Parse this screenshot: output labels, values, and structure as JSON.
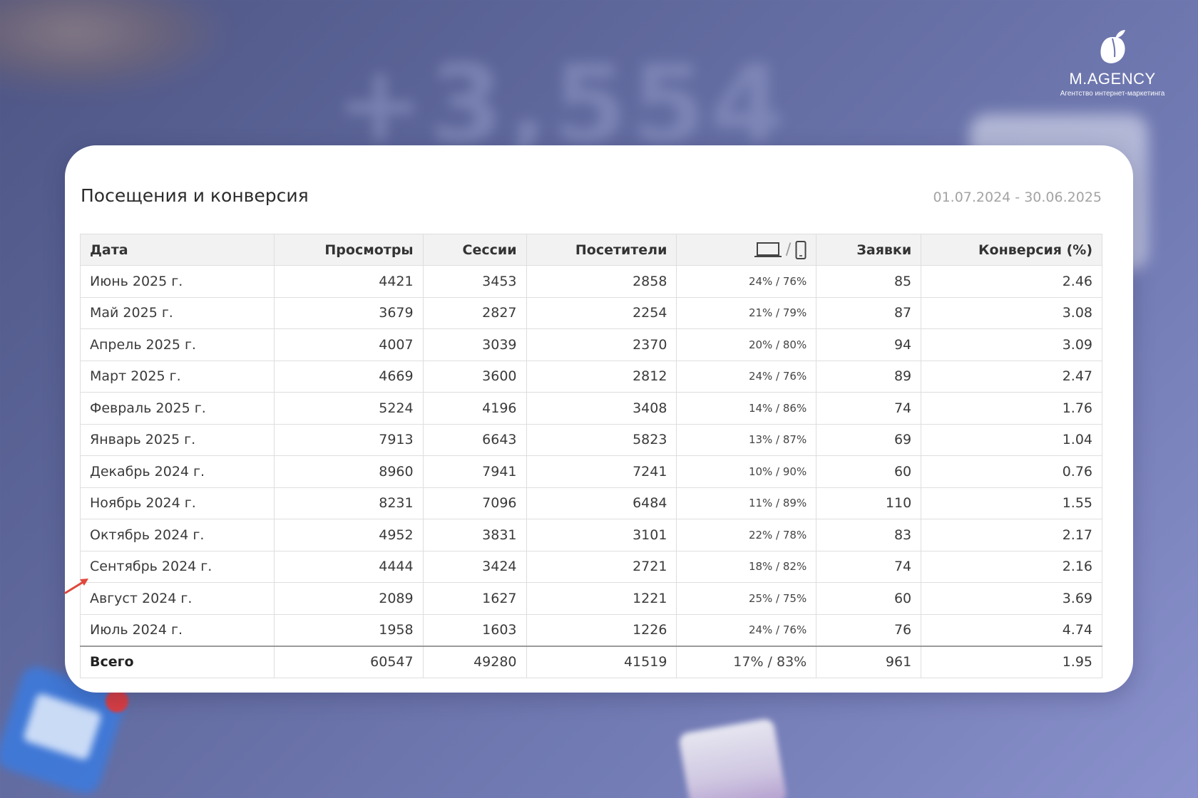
{
  "brand": {
    "name": "M.AGENCY",
    "tagline": "Агентство интернет-маркетинга"
  },
  "background": {
    "big_number": "+3,554"
  },
  "card": {
    "title": "Посещения и конверсия",
    "date_range": "01.07.2024 - 30.06.2025"
  },
  "table": {
    "columns": [
      "Дата",
      "Просмотры",
      "Сессии",
      "Посетители",
      "",
      "Заявки",
      "Конверсия (%)"
    ],
    "device_column_icons": [
      "laptop-icon",
      "phone-icon"
    ],
    "device_separator": "/",
    "rows": [
      {
        "date": "Июнь 2025 г.",
        "views": "4421",
        "sessions": "3453",
        "visitors": "2858",
        "devices": "24% / 76%",
        "leads": "85",
        "conversion": "2.46"
      },
      {
        "date": "Май 2025 г.",
        "views": "3679",
        "sessions": "2827",
        "visitors": "2254",
        "devices": "21% / 79%",
        "leads": "87",
        "conversion": "3.08"
      },
      {
        "date": "Апрель 2025 г.",
        "views": "4007",
        "sessions": "3039",
        "visitors": "2370",
        "devices": "20% / 80%",
        "leads": "94",
        "conversion": "3.09"
      },
      {
        "date": "Март 2025 г.",
        "views": "4669",
        "sessions": "3600",
        "visitors": "2812",
        "devices": "24% / 76%",
        "leads": "89",
        "conversion": "2.47"
      },
      {
        "date": "Февраль 2025 г.",
        "views": "5224",
        "sessions": "4196",
        "visitors": "3408",
        "devices": "14% / 86%",
        "leads": "74",
        "conversion": "1.76"
      },
      {
        "date": "Январь 2025 г.",
        "views": "7913",
        "sessions": "6643",
        "visitors": "5823",
        "devices": "13% / 87%",
        "leads": "69",
        "conversion": "1.04"
      },
      {
        "date": "Декабрь 2024 г.",
        "views": "8960",
        "sessions": "7941",
        "visitors": "7241",
        "devices": "10% / 90%",
        "leads": "60",
        "conversion": "0.76"
      },
      {
        "date": "Ноябрь 2024 г.",
        "views": "8231",
        "sessions": "7096",
        "visitors": "6484",
        "devices": "11% / 89%",
        "leads": "110",
        "conversion": "1.55"
      },
      {
        "date": "Октябрь 2024 г.",
        "views": "4952",
        "sessions": "3831",
        "visitors": "3101",
        "devices": "22% / 78%",
        "leads": "83",
        "conversion": "2.17"
      },
      {
        "date": "Сентябрь 2024 г.",
        "views": "4444",
        "sessions": "3424",
        "visitors": "2721",
        "devices": "18% / 82%",
        "leads": "74",
        "conversion": "2.16"
      },
      {
        "date": "Август 2024 г.",
        "views": "2089",
        "sessions": "1627",
        "visitors": "1221",
        "devices": "25% / 75%",
        "leads": "60",
        "conversion": "3.69"
      },
      {
        "date": "Июль 2024 г.",
        "views": "1958",
        "sessions": "1603",
        "visitors": "1226",
        "devices": "24% / 76%",
        "leads": "76",
        "conversion": "4.74"
      }
    ],
    "total": {
      "date": "Всего",
      "views": "60547",
      "sessions": "49280",
      "visitors": "41519",
      "devices": "17% / 83%",
      "leads": "961",
      "conversion": "1.95"
    }
  },
  "colors": {
    "arrow": "#e0473a",
    "card": "#ffffff",
    "header_bg": "#f2f2f2"
  }
}
